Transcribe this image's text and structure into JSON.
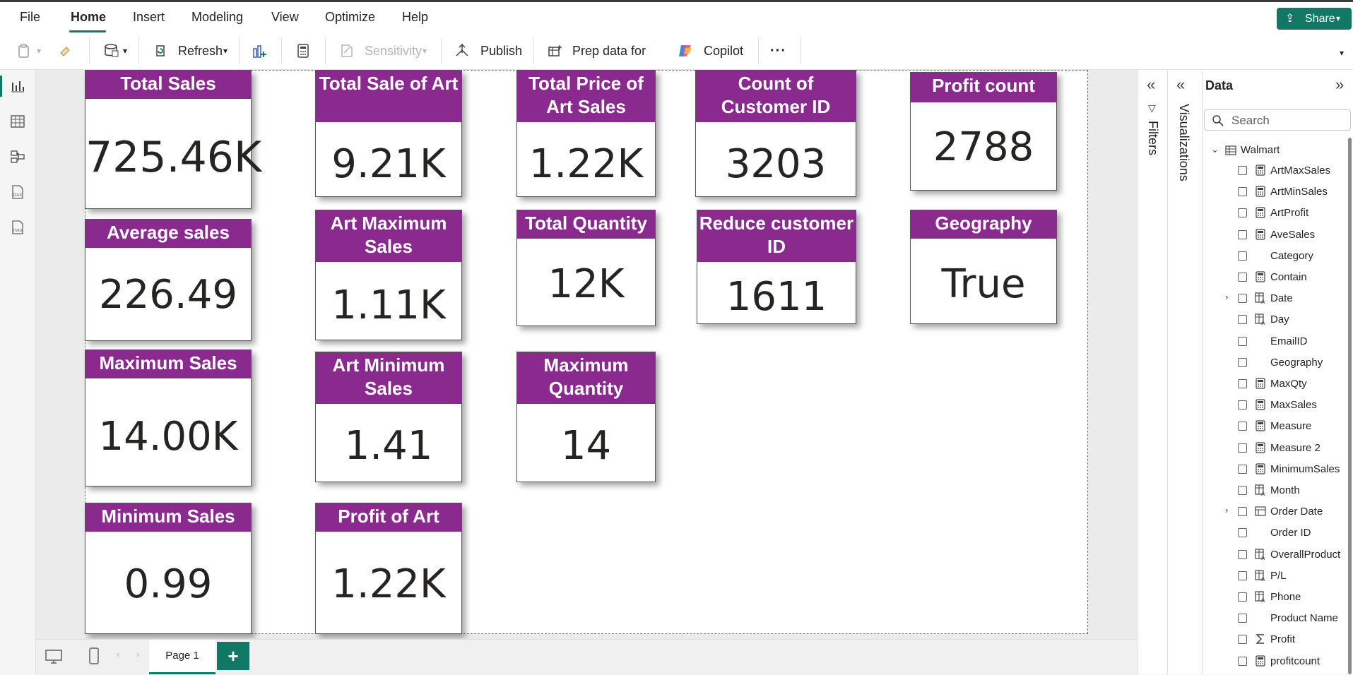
{
  "ribbon": {
    "tabs": [
      "File",
      "Home",
      "Insert",
      "Modeling",
      "View",
      "Optimize",
      "Help"
    ],
    "active_tab": "Home",
    "share_label": "Share",
    "toolbar": {
      "refresh": "Refresh",
      "sensitivity": "Sensitivity",
      "publish": "Publish",
      "prep_ai": "Prep data for AI",
      "copilot": "Copilot",
      "more": "···"
    }
  },
  "cards": [
    {
      "title": "Total Sales",
      "value": "725.46K"
    },
    {
      "title": "Total Sale of Art",
      "value": "9.21K"
    },
    {
      "title": "Total Price of Art Sales",
      "value": "1.22K"
    },
    {
      "title": "Count of Customer ID",
      "value": "3203"
    },
    {
      "title": "Profit count",
      "value": "2788"
    },
    {
      "title": "Average sales",
      "value": "226.49"
    },
    {
      "title": "Art Maximum Sales",
      "value": "1.11K"
    },
    {
      "title": "Total Quantity",
      "value": "12K"
    },
    {
      "title": "Reduce customer ID",
      "value": "1611"
    },
    {
      "title": "Geography",
      "value": "True"
    },
    {
      "title": "Maximum Sales",
      "value": "14.00K"
    },
    {
      "title": "Art Minimum Sales",
      "value": "1.41"
    },
    {
      "title": "Maximum Quantity",
      "value": "14"
    },
    {
      "title": "Minimum Sales",
      "value": "0.99"
    },
    {
      "title": "Profit of Art",
      "value": "1.22K"
    }
  ],
  "panes": {
    "filters_label": "Filters",
    "visualizations_label": "Visualizations",
    "data_title": "Data",
    "search_placeholder": "Search",
    "table_name": "Walmart",
    "fields": [
      {
        "name": "ArtMaxSales",
        "icon": "measure-icon",
        "expand": false
      },
      {
        "name": "ArtMinSales",
        "icon": "measure-icon",
        "expand": false
      },
      {
        "name": "ArtProfit",
        "icon": "measure-icon",
        "expand": false
      },
      {
        "name": "AveSales",
        "icon": "measure-icon",
        "expand": false
      },
      {
        "name": "Category",
        "icon": "none",
        "expand": false
      },
      {
        "name": "Contain",
        "icon": "measure-icon",
        "expand": false
      },
      {
        "name": "Date",
        "icon": "calc-column-icon",
        "expand": true
      },
      {
        "name": "Day",
        "icon": "calc-column-icon",
        "expand": false
      },
      {
        "name": "EmailID",
        "icon": "none",
        "expand": false
      },
      {
        "name": "Geography",
        "icon": "none",
        "expand": false
      },
      {
        "name": "MaxQty",
        "icon": "measure-icon",
        "expand": false
      },
      {
        "name": "MaxSales",
        "icon": "measure-icon",
        "expand": false
      },
      {
        "name": "Measure",
        "icon": "measure-icon",
        "expand": false
      },
      {
        "name": "Measure 2",
        "icon": "measure-icon",
        "expand": false
      },
      {
        "name": "MinimumSales",
        "icon": "measure-icon",
        "expand": false
      },
      {
        "name": "Month",
        "icon": "calc-column-icon",
        "expand": false
      },
      {
        "name": "Order Date",
        "icon": "hierarchy-icon",
        "expand": true
      },
      {
        "name": "Order ID",
        "icon": "none",
        "expand": false
      },
      {
        "name": "OverallProduct",
        "icon": "calc-column-icon",
        "expand": false
      },
      {
        "name": "P/L",
        "icon": "calc-column-icon",
        "expand": false
      },
      {
        "name": "Phone",
        "icon": "calc-column-icon",
        "expand": false
      },
      {
        "name": "Product Name",
        "icon": "none",
        "expand": false
      },
      {
        "name": "Profit",
        "icon": "sigma-icon",
        "expand": false
      },
      {
        "name": "profitcount",
        "icon": "measure-icon",
        "expand": false
      }
    ]
  },
  "page_tabs": {
    "page1": "Page 1",
    "add": "+"
  },
  "colors": {
    "accent": "#117865",
    "card_header": "#8b2a8e"
  }
}
